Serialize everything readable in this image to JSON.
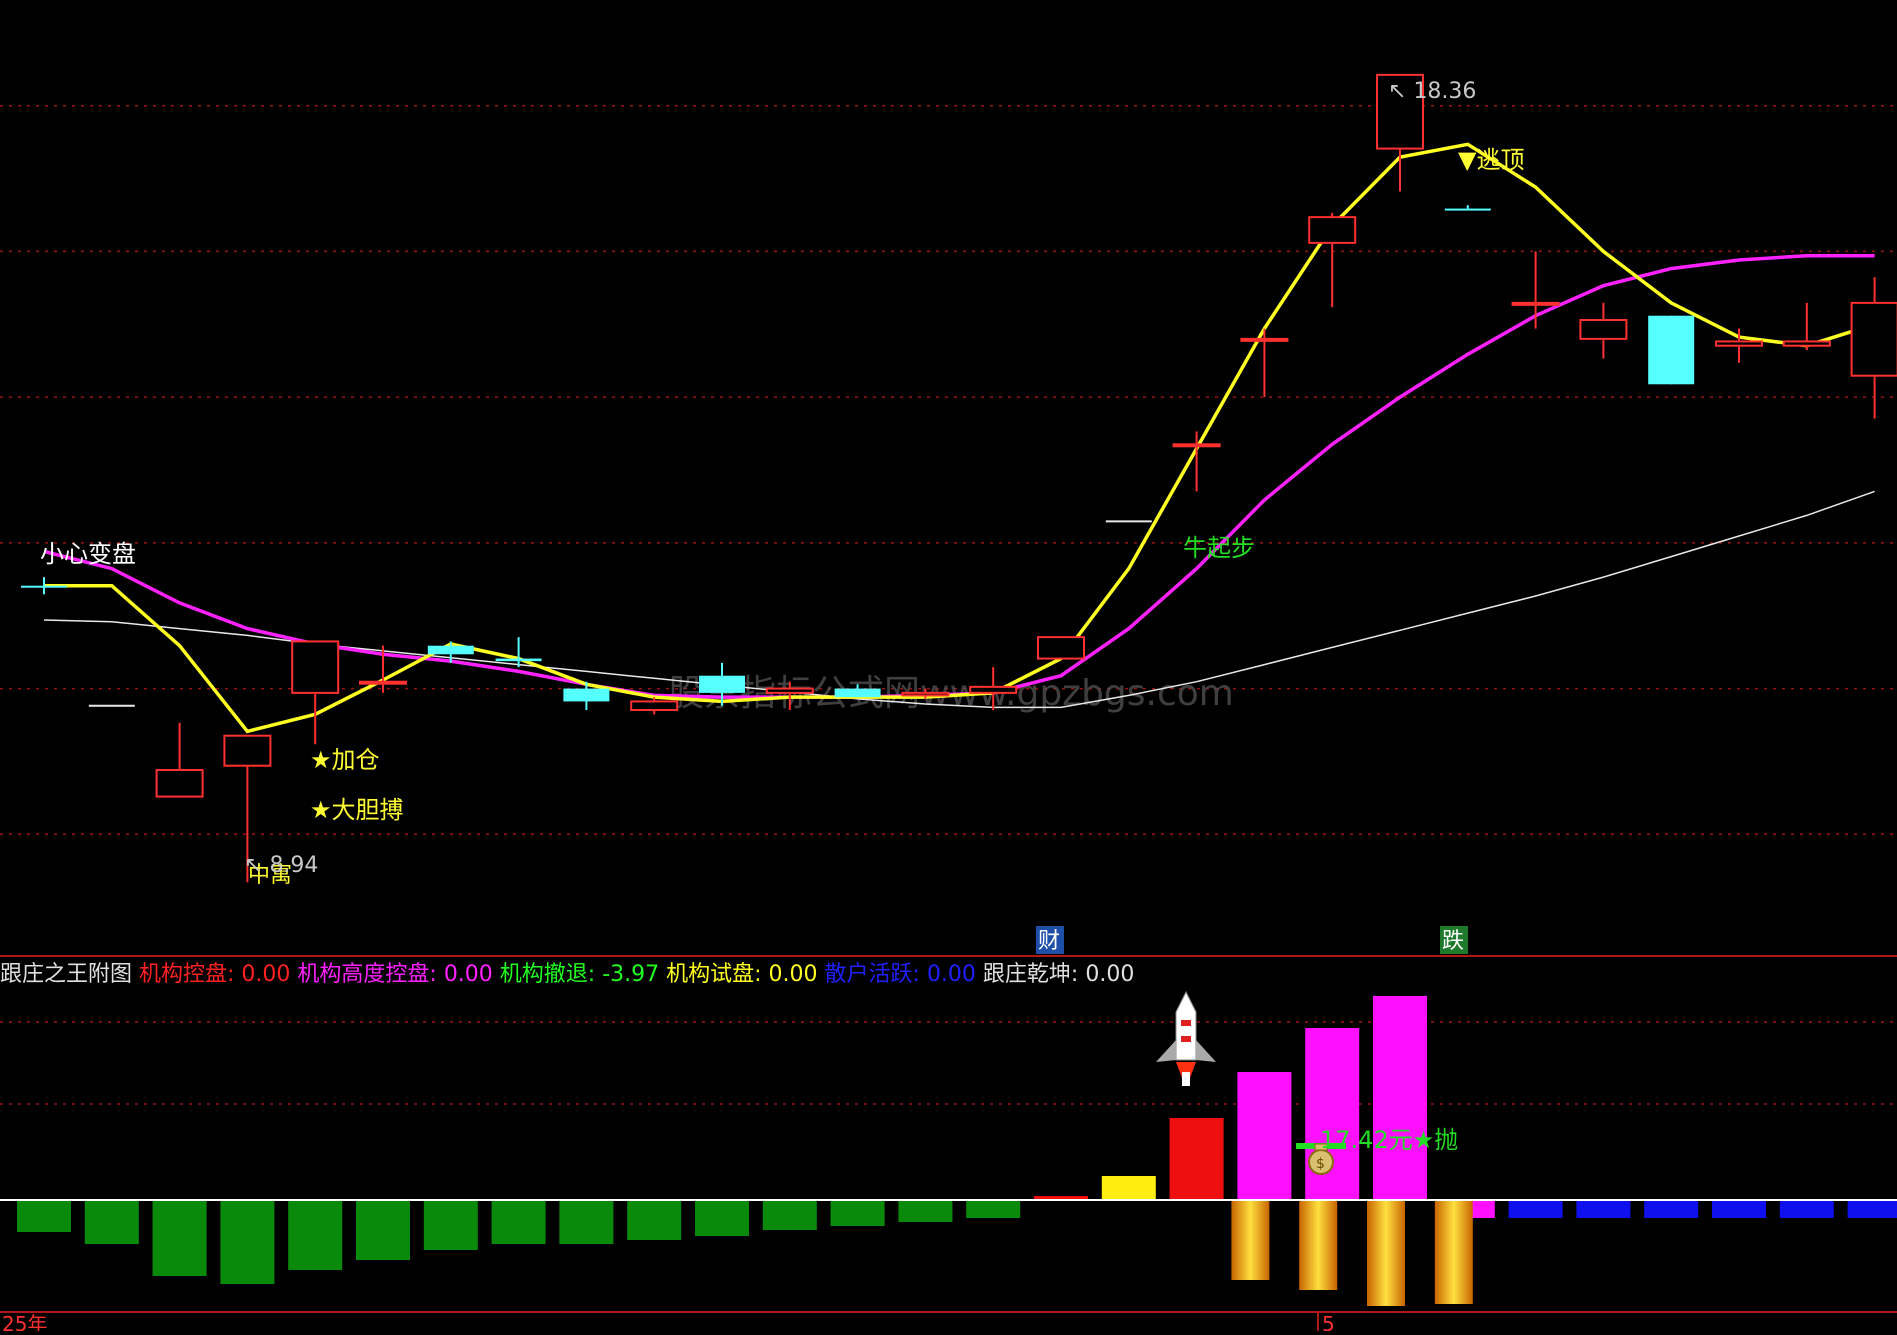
{
  "chart_data": {
    "type": "candlestick",
    "title": "",
    "price_panel": {
      "ylim": [
        8.5,
        19.0
      ],
      "grid_levels": [
        9.5,
        11.2,
        12.9,
        14.6,
        16.3,
        18.0
      ],
      "candles": [
        {
          "o": 12.4,
          "h": 12.5,
          "l": 12.3,
          "c": 12.4,
          "color": "cyan"
        },
        {
          "o": 11.0,
          "h": 11.0,
          "l": 11.0,
          "c": 11.0,
          "color": "white"
        },
        {
          "o": 9.94,
          "h": 10.8,
          "l": 9.94,
          "c": 10.25,
          "color": "red"
        },
        {
          "o": 10.3,
          "h": 10.65,
          "l": 8.94,
          "c": 10.65,
          "color": "red"
        },
        {
          "o": 11.15,
          "h": 11.75,
          "l": 10.55,
          "c": 11.75,
          "color": "red"
        },
        {
          "o": 11.28,
          "h": 11.7,
          "l": 11.15,
          "c": 11.28,
          "color": "red"
        },
        {
          "o": 11.7,
          "h": 11.75,
          "l": 11.5,
          "c": 11.6,
          "color": "cyan"
        },
        {
          "o": 11.55,
          "h": 11.8,
          "l": 11.45,
          "c": 11.52,
          "color": "cyan"
        },
        {
          "o": 11.2,
          "h": 11.28,
          "l": 10.95,
          "c": 11.05,
          "color": "cyan"
        },
        {
          "o": 10.95,
          "h": 11.1,
          "l": 10.9,
          "c": 11.05,
          "color": "red"
        },
        {
          "o": 11.35,
          "h": 11.5,
          "l": 11.0,
          "c": 11.15,
          "color": "cyan"
        },
        {
          "o": 11.15,
          "h": 11.28,
          "l": 10.95,
          "c": 11.2,
          "color": "red"
        },
        {
          "o": 11.2,
          "h": 11.25,
          "l": 11.1,
          "c": 11.1,
          "color": "cyan"
        },
        {
          "o": 11.15,
          "h": 11.2,
          "l": 11.08,
          "c": 11.12,
          "color": "red"
        },
        {
          "o": 11.15,
          "h": 11.45,
          "l": 10.95,
          "c": 11.22,
          "color": "red"
        },
        {
          "o": 11.8,
          "h": 11.8,
          "l": 11.55,
          "c": 11.55,
          "color": "red"
        },
        {
          "o": 13.15,
          "h": 13.15,
          "l": 13.15,
          "c": 13.15,
          "color": "white"
        },
        {
          "o": 14.05,
          "h": 14.2,
          "l": 13.5,
          "c": 14.05,
          "color": "red"
        },
        {
          "o": 15.28,
          "h": 15.4,
          "l": 14.6,
          "c": 15.28,
          "color": "red"
        },
        {
          "o": 16.4,
          "h": 16.75,
          "l": 15.65,
          "c": 16.7,
          "color": "red"
        },
        {
          "o": 17.5,
          "h": 18.36,
          "l": 17.0,
          "c": 18.36,
          "color": "red"
        },
        {
          "o": 16.8,
          "h": 16.84,
          "l": 16.8,
          "c": 16.8,
          "color": "cyan"
        },
        {
          "o": 15.7,
          "h": 16.3,
          "l": 15.4,
          "c": 15.7,
          "color": "red"
        },
        {
          "o": 15.5,
          "h": 15.7,
          "l": 15.05,
          "c": 15.28,
          "color": "red"
        },
        {
          "o": 15.55,
          "h": 15.55,
          "l": 14.75,
          "c": 14.75,
          "color": "cyan"
        },
        {
          "o": 15.2,
          "h": 15.4,
          "l": 15.0,
          "c": 15.25,
          "color": "red"
        },
        {
          "o": 15.2,
          "h": 15.7,
          "l": 15.15,
          "c": 15.25,
          "color": "red"
        },
        {
          "o": 14.85,
          "h": 16.0,
          "l": 14.35,
          "c": 15.7,
          "color": "red"
        }
      ],
      "ma_yellow": [
        12.4,
        12.4,
        11.7,
        10.7,
        10.9,
        11.3,
        11.72,
        11.55,
        11.25,
        11.1,
        11.05,
        11.1,
        11.1,
        11.1,
        11.15,
        11.55,
        12.6,
        14.0,
        15.4,
        16.6,
        17.4,
        17.55,
        17.05,
        16.3,
        15.7,
        15.3,
        15.2,
        15.45
      ],
      "ma_magenta": [
        12.8,
        12.6,
        12.2,
        11.9,
        11.72,
        11.6,
        11.52,
        11.4,
        11.25,
        11.12,
        11.1,
        11.1,
        11.1,
        11.12,
        11.15,
        11.35,
        11.9,
        12.6,
        13.4,
        14.05,
        14.6,
        15.1,
        15.55,
        15.9,
        16.1,
        16.2,
        16.25,
        16.25
      ],
      "ma_white": [
        12.0,
        11.98,
        11.9,
        11.82,
        11.72,
        11.64,
        11.56,
        11.48,
        11.4,
        11.32,
        11.24,
        11.16,
        11.08,
        11.02,
        10.98,
        10.98,
        11.12,
        11.28,
        11.48,
        11.68,
        11.88,
        12.08,
        12.28,
        12.5,
        12.74,
        12.98,
        13.22,
        13.5
      ],
      "price_labels": {
        "high": "18.36",
        "low": "8.94"
      },
      "annotations": [
        "小心变盘",
        "★加仓",
        "★大胆搏",
        "牛起步",
        "▼逃顶",
        "中寓"
      ],
      "badges": [
        {
          "text": "财",
          "bg": "#1e4fa8"
        },
        {
          "text": "跌",
          "bg": "#1f7a2c"
        }
      ]
    },
    "indicator_panel": {
      "name": "跟庄之王附图",
      "values": [
        {
          "label": "机构控盘",
          "value": "0.00",
          "color": "#ff2020"
        },
        {
          "label": "机构高度控盘",
          "value": "0.00",
          "color": "#ff20ff"
        },
        {
          "label": "机构撤退",
          "value": "-3.97",
          "color": "#20ff20"
        },
        {
          "label": "机构试盘",
          "value": "0.00",
          "color": "#ffff20"
        },
        {
          "label": "散户活跃",
          "value": "0.00",
          "color": "#2020ff"
        },
        {
          "label": "跟庄乾坤",
          "value": "0.00",
          "color": "#e0e0e0"
        }
      ],
      "bars": [
        -1.6,
        -2.2,
        -3.8,
        -4.2,
        -3.5,
        -3.0,
        -2.5,
        -2.2,
        -2.2,
        -2.0,
        -1.8,
        -1.5,
        -1.3,
        -1.1,
        -0.9,
        0.2,
        1.2,
        4.1,
        6.4,
        8.6,
        10.2,
        -0.9,
        -0.9,
        -0.9,
        -0.9,
        -0.9,
        -0.9,
        -0.9
      ],
      "bar_colors": [
        "green",
        "green",
        "green",
        "green",
        "green",
        "green",
        "green",
        "green",
        "green",
        "green",
        "green",
        "green",
        "green",
        "green",
        "green",
        "red",
        "yellow",
        "red",
        "magenta",
        "magenta",
        "magenta",
        "magenta",
        "blue",
        "blue",
        "blue",
        "blue",
        "blue",
        "blue",
        "blue"
      ],
      "orange_bars": [
        0,
        0,
        0,
        0,
        0,
        0,
        0,
        0,
        0,
        0,
        0,
        0,
        0,
        0,
        0,
        0,
        0,
        0,
        4.0,
        4.5,
        5.3,
        5.2,
        0,
        0,
        0,
        0,
        0,
        0
      ],
      "sell_label": "17.42元★抛",
      "xlabels": [
        "25年",
        "5"
      ]
    }
  },
  "watermark": "股票指标公式网www.gpzbgs.com"
}
